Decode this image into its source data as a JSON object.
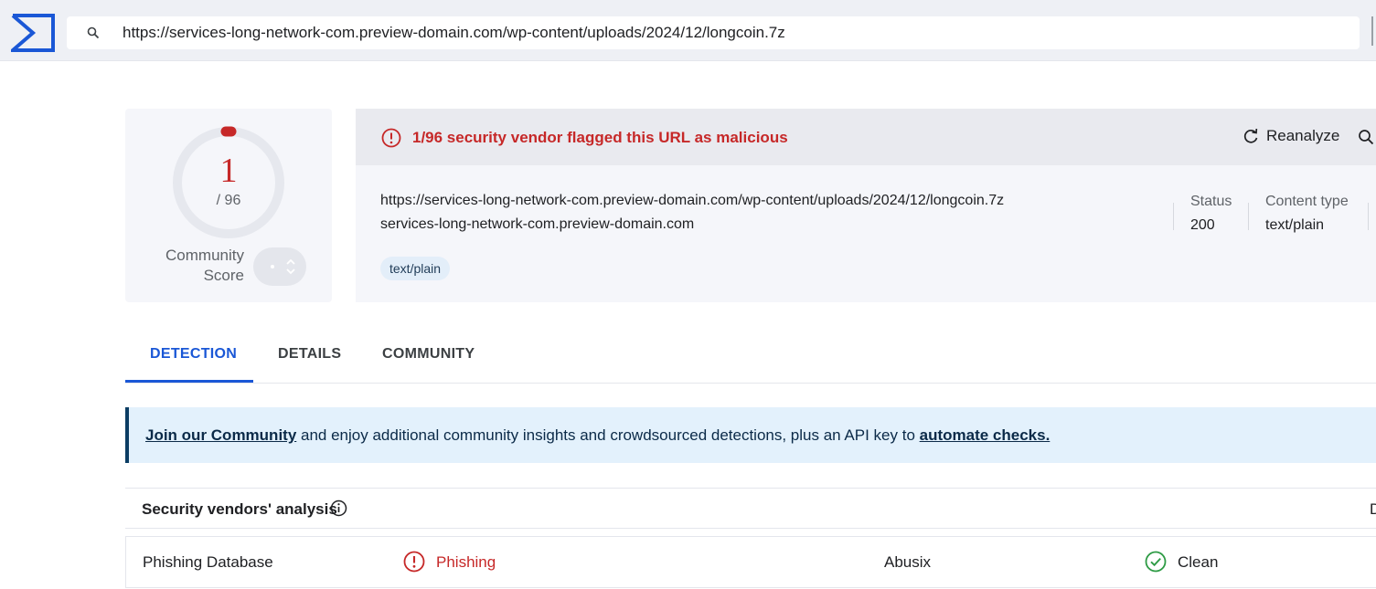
{
  "topbar": {
    "search_value": "https://services-long-network-com.preview-domain.com/wp-content/uploads/2024/12/longcoin.7z"
  },
  "score": {
    "detections": "1",
    "total": "/ 96",
    "community_label_line1": "Community",
    "community_label_line2": "Score"
  },
  "summary": {
    "alert_text": "1/96 security vendor flagged this URL as malicious",
    "reanalyze_label": "Reanalyze",
    "url": "https://services-long-network-com.preview-domain.com/wp-content/uploads/2024/12/longcoin.7z",
    "host": "services-long-network-com.preview-domain.com",
    "tag": "text/plain",
    "status_label": "Status",
    "status_value": "200",
    "content_type_label": "Content type",
    "content_type_value": "text/plain"
  },
  "tabs": [
    {
      "label": "DETECTION",
      "active": true
    },
    {
      "label": "DETAILS",
      "active": false
    },
    {
      "label": "COMMUNITY",
      "active": false
    }
  ],
  "banner": {
    "join_link": "Join our Community",
    "middle_text": " and enjoy additional community insights and crowdsourced detections, plus an API key to ",
    "automate_link": "automate checks."
  },
  "vendors": {
    "title": "Security vendors' analysis",
    "cut_text": "D",
    "rows": [
      {
        "vendor_a": "Phishing Database",
        "result_a": "Phishing",
        "result_a_status": "malicious",
        "vendor_b": "Abusix",
        "result_b": "Clean",
        "result_b_status": "clean"
      }
    ]
  },
  "colors": {
    "brand": "#1a57d6",
    "malicious": "#c62828",
    "clean": "#2e9b45",
    "banner_bg": "#e3f1fc"
  },
  "icons": [
    "logo-icon",
    "search-icon",
    "alert-circle-icon",
    "reanalyze-icon",
    "similar-search-icon",
    "info-icon",
    "phishing-alert-icon",
    "clean-check-icon"
  ]
}
